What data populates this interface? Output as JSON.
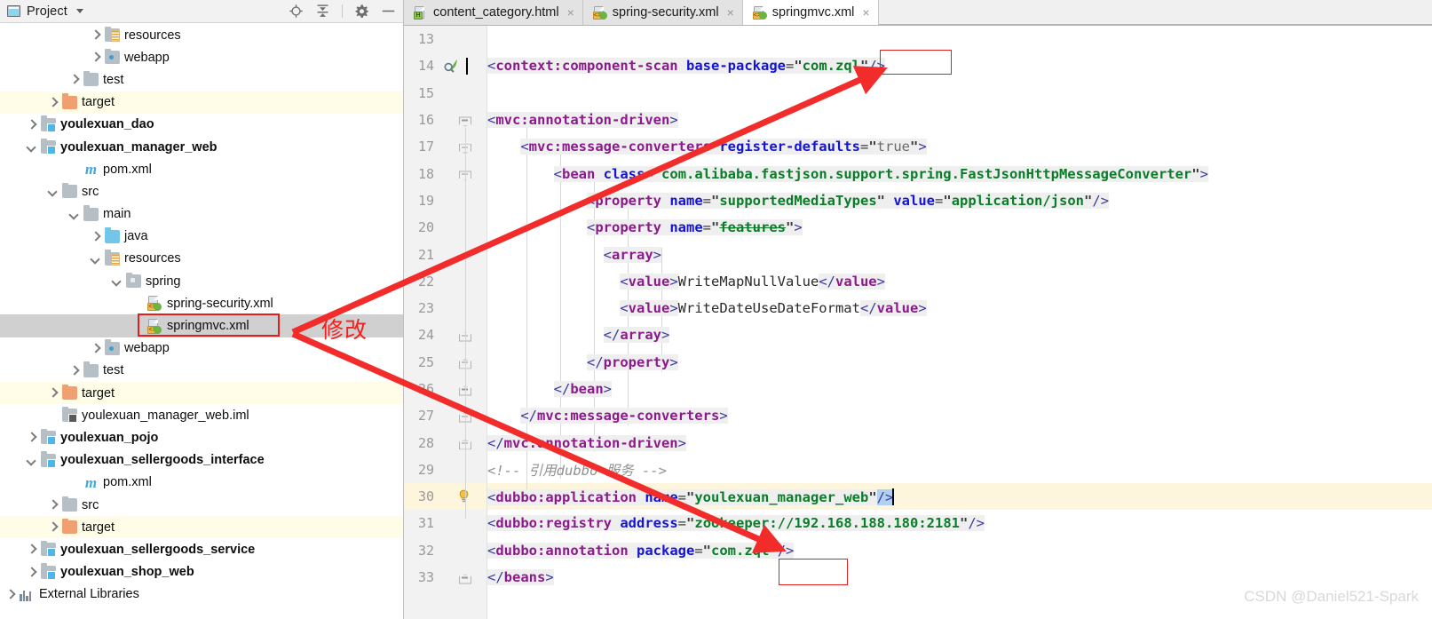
{
  "panel": {
    "title": "Project",
    "icons": [
      "project-icon",
      "chevron-down-icon",
      "locate-target-icon",
      "collapse-all-icon",
      "gear-icon",
      "minimize-icon"
    ]
  },
  "tree": [
    {
      "label": "resources",
      "indent": 4,
      "arrow": "right",
      "icon": "folder-res",
      "bold": false,
      "hl": "none"
    },
    {
      "label": "webapp",
      "indent": 4,
      "arrow": "right",
      "icon": "folder-web",
      "bold": false,
      "hl": "none"
    },
    {
      "label": "test",
      "indent": 3,
      "arrow": "right",
      "icon": "folder-gray",
      "bold": false,
      "hl": "none"
    },
    {
      "label": "target",
      "indent": 2,
      "arrow": "right",
      "icon": "folder-orange",
      "bold": false,
      "hl": "yellow"
    },
    {
      "label": "youlexuan_dao",
      "indent": 1,
      "arrow": "right",
      "icon": "module",
      "bold": true,
      "hl": "none"
    },
    {
      "label": "youlexuan_manager_web",
      "indent": 1,
      "arrow": "down",
      "icon": "module",
      "bold": true,
      "hl": "none"
    },
    {
      "label": "pom.xml",
      "indent": 3,
      "arrow": "none",
      "icon": "maven",
      "bold": false,
      "hl": "none"
    },
    {
      "label": "src",
      "indent": 2,
      "arrow": "down",
      "icon": "folder-gray",
      "bold": false,
      "hl": "none"
    },
    {
      "label": "main",
      "indent": 3,
      "arrow": "down",
      "icon": "folder-gray",
      "bold": false,
      "hl": "none"
    },
    {
      "label": "java",
      "indent": 4,
      "arrow": "right",
      "icon": "folder-blue",
      "bold": false,
      "hl": "none"
    },
    {
      "label": "resources",
      "indent": 4,
      "arrow": "down",
      "icon": "folder-res",
      "bold": false,
      "hl": "none"
    },
    {
      "label": "spring",
      "indent": 5,
      "arrow": "down",
      "icon": "folder-spring",
      "bold": false,
      "hl": "none"
    },
    {
      "label": "spring-security.xml",
      "indent": 6,
      "arrow": "none",
      "icon": "xmlfile",
      "bold": false,
      "hl": "none"
    },
    {
      "label": "springmvc.xml",
      "indent": 6,
      "arrow": "none",
      "icon": "xmlfile",
      "bold": false,
      "hl": "gray"
    },
    {
      "label": "webapp",
      "indent": 4,
      "arrow": "right",
      "icon": "folder-web",
      "bold": false,
      "hl": "none"
    },
    {
      "label": "test",
      "indent": 3,
      "arrow": "right",
      "icon": "folder-gray",
      "bold": false,
      "hl": "none"
    },
    {
      "label": "target",
      "indent": 2,
      "arrow": "right",
      "icon": "folder-orange",
      "bold": false,
      "hl": "yellow"
    },
    {
      "label": "youlexuan_manager_web.iml",
      "indent": 2,
      "arrow": "none",
      "icon": "iml",
      "bold": false,
      "hl": "none"
    },
    {
      "label": "youlexuan_pojo",
      "indent": 1,
      "arrow": "right",
      "icon": "module",
      "bold": true,
      "hl": "none"
    },
    {
      "label": "youlexuan_sellergoods_interface",
      "indent": 1,
      "arrow": "down",
      "icon": "module",
      "bold": true,
      "hl": "none"
    },
    {
      "label": "pom.xml",
      "indent": 3,
      "arrow": "none",
      "icon": "maven",
      "bold": false,
      "hl": "none"
    },
    {
      "label": "src",
      "indent": 2,
      "arrow": "right",
      "icon": "folder-gray",
      "bold": false,
      "hl": "none"
    },
    {
      "label": "target",
      "indent": 2,
      "arrow": "right",
      "icon": "folder-orange",
      "bold": false,
      "hl": "yellow"
    },
    {
      "label": "youlexuan_sellergoods_service",
      "indent": 1,
      "arrow": "right",
      "icon": "module",
      "bold": true,
      "hl": "none"
    },
    {
      "label": "youlexuan_shop_web",
      "indent": 1,
      "arrow": "right",
      "icon": "module",
      "bold": true,
      "hl": "none"
    },
    {
      "label": "External Libraries",
      "indent": 0,
      "arrow": "right",
      "icon": "extlib",
      "bold": false,
      "hl": "none"
    }
  ],
  "annotation": {
    "tree_note": "修改"
  },
  "tabs": [
    {
      "label": "content_category.html",
      "icon": "html-file-icon",
      "badge": "H",
      "active": false,
      "close": "×"
    },
    {
      "label": "spring-security.xml",
      "icon": "spring-xml-icon",
      "badge": "<>",
      "active": false,
      "close": "×"
    },
    {
      "label": "springmvc.xml",
      "icon": "spring-xml-icon",
      "badge": "<>",
      "active": true,
      "close": "×"
    }
  ],
  "editor": {
    "first_line": 13,
    "lines": [
      {
        "n": 13,
        "text": ""
      },
      {
        "n": 14,
        "text": "<context:component-scan base-package=\"com.zql\"/>"
      },
      {
        "n": 15,
        "text": ""
      },
      {
        "n": 16,
        "text": "<mvc:annotation-driven>"
      },
      {
        "n": 17,
        "text": "    <mvc:message-converters register-defaults=\"true\">"
      },
      {
        "n": 18,
        "text": "        <bean class=\"com.alibaba.fastjson.support.spring.FastJsonHttpMessageConverter\">"
      },
      {
        "n": 19,
        "text": "            <property name=\"supportedMediaTypes\" value=\"application/json\"/>"
      },
      {
        "n": 20,
        "text": "            <property name=\"features\">"
      },
      {
        "n": 21,
        "text": "              <array>"
      },
      {
        "n": 22,
        "text": "                <value>WriteMapNullValue</value>"
      },
      {
        "n": 23,
        "text": "                <value>WriteDateUseDateFormat</value>"
      },
      {
        "n": 24,
        "text": "              </array>"
      },
      {
        "n": 25,
        "text": "            </property>"
      },
      {
        "n": 26,
        "text": "        </bean>"
      },
      {
        "n": 27,
        "text": "    </mvc:message-converters>"
      },
      {
        "n": 28,
        "text": "</mvc:annotation-driven>"
      },
      {
        "n": 29,
        "text": "<!-- 引用dubbo 服务 -->"
      },
      {
        "n": 30,
        "text": "<dubbo:application name=\"youlexuan_manager_web\" />"
      },
      {
        "n": 31,
        "text": "<dubbo:registry address=\"zookeeper://192.168.188.180:2181\"/>"
      },
      {
        "n": 32,
        "text": "<dubbo:annotation package=\"com.zql\" />"
      },
      {
        "n": 33,
        "text": "</beans>"
      }
    ],
    "gutter_icons": {
      "14": "spring-bean-icon",
      "30": "intention-bulb-icon"
    },
    "highlighted_values": [
      "com.zql",
      "com.zql"
    ]
  },
  "colors": {
    "accent_red": "#e02020",
    "tag": "#8c1a8c",
    "attr": "#1414d2",
    "value": "#0a7d28",
    "comment": "#909090",
    "highlight_yellow": "#fdf6dd",
    "selection_gray": "#d0d0d0"
  },
  "watermark": "CSDN @Daniel521-Spark"
}
